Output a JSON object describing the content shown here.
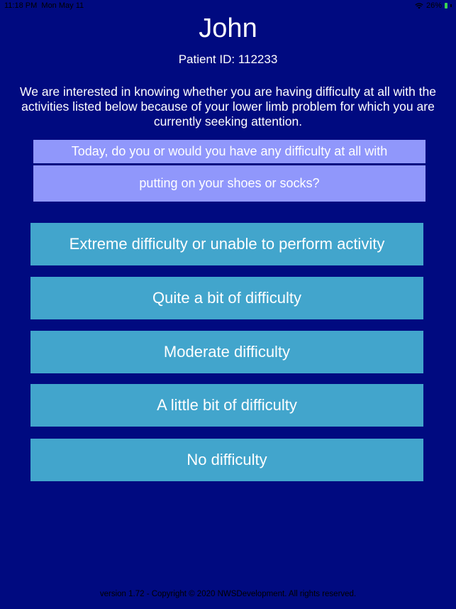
{
  "status_bar": {
    "time": "11:18 PM",
    "date": "Mon May 11",
    "battery": "26%"
  },
  "header": {
    "name": "John",
    "patient_id": "Patient ID: 112233"
  },
  "intro_text": "We are interested in knowing whether you are having difficulty at all with the activities listed below because of your lower limb problem for which you are currently seeking attention.",
  "question": {
    "prompt": "Today, do you or would you have any difficulty at all with",
    "activity": "putting on your shoes or socks?"
  },
  "answers": [
    {
      "label": "Extreme difficulty or unable to perform activity"
    },
    {
      "label": "Quite a bit of difficulty"
    },
    {
      "label": "Moderate difficulty"
    },
    {
      "label": "A little bit of difficulty"
    },
    {
      "label": "No difficulty"
    }
  ],
  "footer": "version 1.72 - Copyright © 2020 NWSDevelopment. All rights reserved.",
  "colors": {
    "background": "#000a80",
    "question_box": "#9097fb",
    "answer_button": "#42a5cc"
  }
}
